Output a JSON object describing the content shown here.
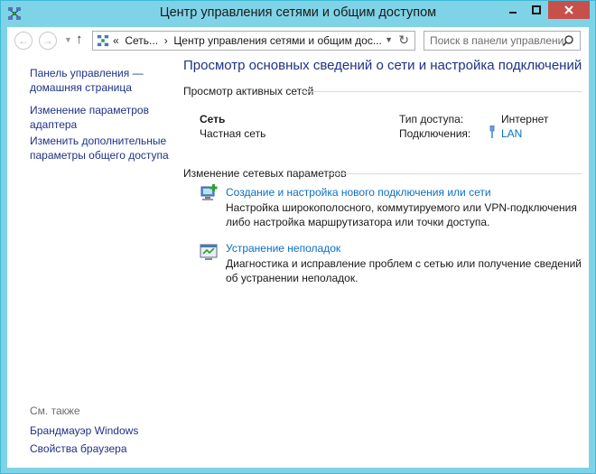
{
  "window": {
    "title": "Центр управления сетями и общим доступом",
    "accent": "#7fd3e6",
    "close_color": "#c7504b",
    "controls": {
      "minimize": "minimize-icon",
      "maximize": "maximize-icon",
      "close": "close-icon"
    }
  },
  "navbar": {
    "back_icon": "back-arrow-icon",
    "forward_icon": "forward-arrow-icon",
    "up_icon": "up-arrow-icon",
    "address": {
      "prefix": "«",
      "crumb_1": "Сеть...",
      "separator": "›",
      "crumb_2": "Центр управления сетями и общим дос..."
    },
    "search": {
      "placeholder": "Поиск в панели управления"
    }
  },
  "sidebar": {
    "home": "Панель управления — домашняя страница",
    "change_adapter": "Изменение параметров адаптера",
    "change_sharing": "Изменить дополнительные параметры общего доступа",
    "see_also_title": "См. также",
    "firewall": "Брандмауэр Windows",
    "browser_props": "Свойства браузера"
  },
  "main": {
    "title": "Просмотр основных сведений о сети и настройка подключений",
    "active_networks_header": "Просмотр активных сетей",
    "network_name": "Сеть",
    "network_type": "Частная сеть",
    "access_type_label": "Тип доступа:",
    "access_type_value": "Интернет",
    "connections_label": "Подключения:",
    "connections_value": "LAN",
    "change_settings_header": "Изменение сетевых параметров",
    "task1_link": "Создание и настройка нового подключения или сети",
    "task1_desc": "Настройка широкополосного, коммутируемого или VPN-подключения либо настройка маршрутизатора или точки доступа.",
    "task2_link": "Устранение неполадок",
    "task2_desc": "Диагностика и исправление проблем с сетью или получение сведений об устранении неполадок."
  }
}
